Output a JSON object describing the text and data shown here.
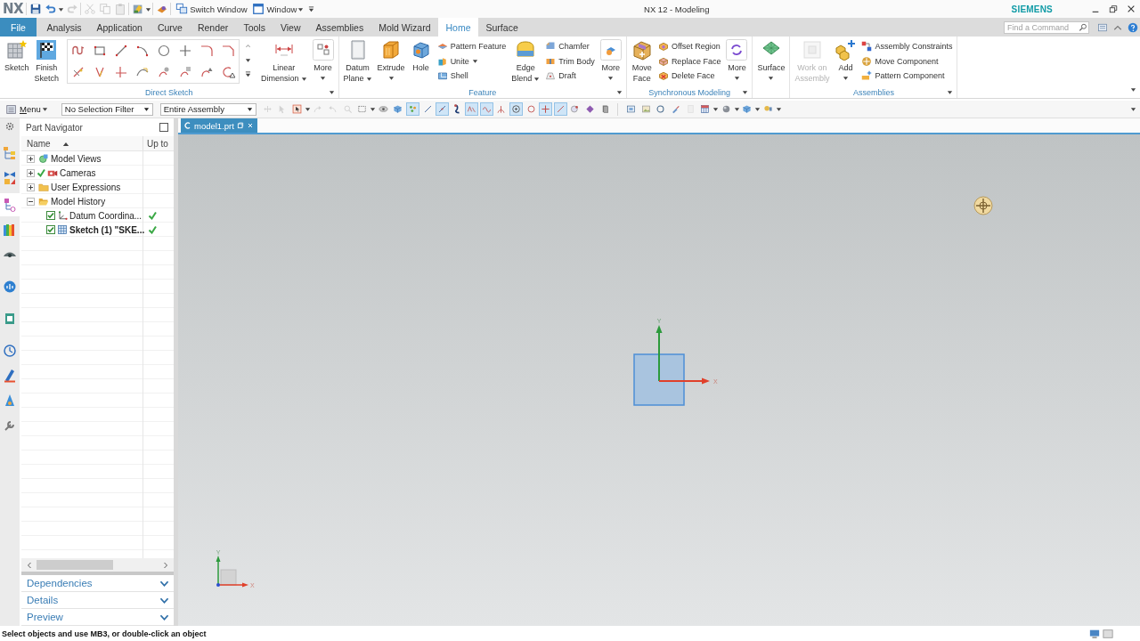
{
  "title_bar": {
    "logo": "NX",
    "quick_access": [
      {
        "disabled": false,
        "dropdown": false
      },
      {
        "disabled": false,
        "dropdown": true
      },
      {
        "disabled": true,
        "dropdown": false
      },
      {
        "disabled": true,
        "dropdown": false
      },
      {
        "disabled": true,
        "dropdown": false
      },
      {
        "disabled": true,
        "dropdown": false
      },
      {
        "disabled": false,
        "dropdown": true
      },
      {
        "disabled": false,
        "dropdown": false
      }
    ],
    "switch_window": "Switch Window",
    "window_menu": "Window",
    "title": "NX 12 - Modeling",
    "brand": "SIEMENS"
  },
  "menu_tabs": [
    {
      "label": "File",
      "kind": "file",
      "selected": false
    },
    {
      "label": "Analysis",
      "kind": "tab",
      "selected": false
    },
    {
      "label": "Application",
      "kind": "tab",
      "selected": false
    },
    {
      "label": "Curve",
      "kind": "tab",
      "selected": false
    },
    {
      "label": "Render",
      "kind": "tab",
      "selected": false
    },
    {
      "label": "Tools",
      "kind": "tab",
      "selected": false
    },
    {
      "label": "View",
      "kind": "tab",
      "selected": false
    },
    {
      "label": "Assemblies",
      "kind": "tab",
      "selected": false
    },
    {
      "label": "Mold Wizard",
      "kind": "tab",
      "selected": false
    },
    {
      "label": "Home",
      "kind": "tab",
      "selected": true
    },
    {
      "label": "Surface",
      "kind": "tab",
      "selected": false
    }
  ],
  "command_search": {
    "placeholder": "Find a Command"
  },
  "ribbon": {
    "groups": [
      {
        "label": "Direct Sketch",
        "items": [
          {
            "kind": "large",
            "label": "Sketch",
            "dropdown": false,
            "disabled": false
          },
          {
            "kind": "large",
            "label": "Finish\nSketch",
            "dropdown": false,
            "disabled": false
          },
          {
            "kind": "gallery"
          },
          {
            "kind": "large",
            "label": "Linear\nDimension",
            "dropdown": true,
            "disabled": false
          },
          {
            "kind": "more",
            "label": "More",
            "dropdown": true,
            "disabled": false
          }
        ]
      },
      {
        "label": "Feature",
        "items": [
          {
            "kind": "large",
            "label": "Datum\nPlane",
            "dropdown": true,
            "disabled": false
          },
          {
            "kind": "split",
            "label": "Extrude",
            "dropdown": true,
            "disabled": false
          },
          {
            "kind": "large",
            "label": "Hole",
            "dropdown": false,
            "disabled": false
          },
          {
            "kind": "stack",
            "items": [
              {
                "label": "Pattern Feature",
                "dropdown": false
              },
              {
                "label": "Unite",
                "dropdown": true
              },
              {
                "label": "Shell",
                "dropdown": false
              }
            ]
          },
          {
            "kind": "large",
            "label": "Edge\nBlend",
            "dropdown": true,
            "disabled": false
          },
          {
            "kind": "stack",
            "items": [
              {
                "label": "Chamfer",
                "dropdown": false
              },
              {
                "label": "Trim Body",
                "dropdown": false
              },
              {
                "label": "Draft",
                "dropdown": false
              }
            ]
          },
          {
            "kind": "more",
            "label": "More",
            "dropdown": true,
            "disabled": false
          }
        ]
      },
      {
        "label": "Synchronous Modeling",
        "items": [
          {
            "kind": "large",
            "label": "Move\nFace",
            "dropdown": false,
            "disabled": false
          },
          {
            "kind": "stack",
            "items": [
              {
                "label": "Offset Region",
                "dropdown": false
              },
              {
                "label": "Replace Face",
                "dropdown": false
              },
              {
                "label": "Delete Face",
                "dropdown": false
              }
            ]
          },
          {
            "kind": "more",
            "label": "More",
            "dropdown": true,
            "disabled": false
          }
        ]
      },
      {
        "items": [
          {
            "kind": "split",
            "label": "Surface",
            "dropdown": true,
            "disabled": false
          }
        ]
      },
      {
        "label": "Assemblies",
        "items": [
          {
            "kind": "large",
            "label": "Work on\nAssembly",
            "dropdown": false,
            "disabled": true
          },
          {
            "kind": "split",
            "label": "Add",
            "dropdown": true,
            "disabled": false
          },
          {
            "kind": "stack",
            "items": [
              {
                "label": "Assembly Constraints",
                "dropdown": false
              },
              {
                "label": "Move Component",
                "dropdown": false
              },
              {
                "label": "Pattern Component",
                "dropdown": false
              }
            ]
          }
        ]
      }
    ]
  },
  "toolbar": {
    "menu": "Menu",
    "selection_filter": "No Selection Filter",
    "assembly_scope": "Entire Assembly",
    "selection_tools": [
      {
        "on": false,
        "disabled": true,
        "dropdown": false
      },
      {
        "on": false,
        "disabled": true,
        "dropdown": false
      },
      {
        "on": false,
        "disabled": false,
        "dropdown": true
      },
      {
        "on": false,
        "disabled": true,
        "dropdown": false
      },
      {
        "on": false,
        "disabled": true,
        "dropdown": false
      },
      {
        "on": false,
        "disabled": true,
        "dropdown": false
      },
      {
        "on": false,
        "disabled": false,
        "dropdown": true
      },
      {
        "on": false,
        "disabled": false,
        "dropdown": false
      },
      {
        "on": false,
        "disabled": false,
        "dropdown": false
      },
      {
        "on": true,
        "disabled": false,
        "dropdown": false
      },
      {
        "on": false,
        "disabled": false,
        "dropdown": false
      },
      {
        "on": true,
        "disabled": false,
        "dropdown": false
      },
      {
        "on": false,
        "disabled": false,
        "dropdown": false
      },
      {
        "on": true,
        "disabled": false,
        "dropdown": false
      },
      {
        "on": true,
        "disabled": false,
        "dropdown": false
      },
      {
        "on": false,
        "disabled": false,
        "dropdown": false
      },
      {
        "on": true,
        "disabled": false,
        "dropdown": false
      },
      {
        "on": false,
        "disabled": false,
        "dropdown": false
      },
      {
        "on": true,
        "disabled": false,
        "dropdown": false
      },
      {
        "on": true,
        "disabled": false,
        "dropdown": false
      },
      {
        "on": false,
        "disabled": false,
        "dropdown": false
      },
      {
        "on": false,
        "disabled": false,
        "dropdown": false
      },
      {
        "on": false,
        "disabled": false,
        "dropdown": false
      }
    ],
    "view_tools": [
      {
        "on": false,
        "disabled": false,
        "dropdown": false
      },
      {
        "on": false,
        "disabled": false,
        "dropdown": false
      },
      {
        "on": false,
        "disabled": false,
        "dropdown": false
      },
      {
        "on": false,
        "disabled": false,
        "dropdown": false
      },
      {
        "on": false,
        "disabled": true,
        "dropdown": false
      },
      {
        "on": false,
        "disabled": false,
        "dropdown": true
      },
      {
        "on": false,
        "disabled": false,
        "dropdown": true
      },
      {
        "on": false,
        "disabled": false,
        "dropdown": true
      },
      {
        "on": false,
        "disabled": false,
        "dropdown": true
      }
    ]
  },
  "resource_bar": [
    {
      "selected": false
    },
    {
      "selected": false
    },
    {
      "selected": true
    },
    {
      "selected": false
    },
    {
      "selected": false
    },
    {
      "selected": false
    },
    {
      "selected": false
    },
    {
      "selected": false
    },
    {
      "selected": false
    },
    {
      "selected": false
    },
    {
      "selected": false
    }
  ],
  "part_navigator": {
    "title": "Part Navigator",
    "columns": [
      "Name",
      "Up to"
    ],
    "tree": [
      {
        "label": "Model Views",
        "expanded": false,
        "checked": false
      },
      {
        "label": "Cameras",
        "expanded": false,
        "checked": true
      },
      {
        "label": "User Expressions",
        "expanded": false,
        "checked": false
      },
      {
        "label": "Model History",
        "expanded": true,
        "checked": false,
        "children": [
          {
            "label": "Datum Coordina...",
            "checked": true,
            "current": false,
            "up_to_date": true
          },
          {
            "label": "Sketch (1) \"SKE...",
            "checked": true,
            "current": true,
            "up_to_date": true
          }
        ]
      }
    ],
    "panels": [
      {
        "label": "Dependencies",
        "expanded": false
      },
      {
        "label": "Details",
        "expanded": false
      },
      {
        "label": "Preview",
        "expanded": false
      }
    ]
  },
  "document_tabs": [
    {
      "label": "model1.prt",
      "selected": true
    }
  ],
  "viewport": {
    "datum_csys": {
      "x_label": "X",
      "y_label": "Y"
    },
    "view_triad": {
      "x_label": "X",
      "y_label": "Y"
    }
  },
  "status_bar": {
    "message": "Select objects and use MB3, or double-click an object"
  }
}
